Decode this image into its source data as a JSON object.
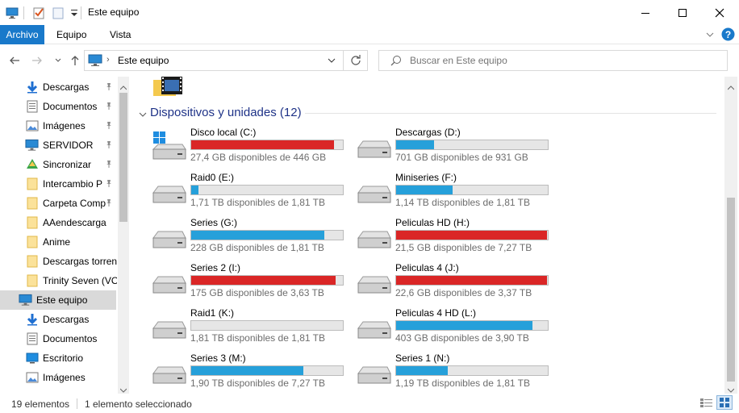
{
  "window": {
    "title": "Este equipo"
  },
  "ribbon": {
    "tabs": [
      "Archivo",
      "Equipo",
      "Vista"
    ]
  },
  "address": {
    "path": "Este equipo"
  },
  "search": {
    "placeholder": "Buscar en Este equipo"
  },
  "sidebar": {
    "items": [
      {
        "label": "Descargas",
        "icon": "download-arrow-icon",
        "pinned": true
      },
      {
        "label": "Documentos",
        "icon": "document-icon",
        "pinned": true
      },
      {
        "label": "Imágenes",
        "icon": "pictures-icon",
        "pinned": true
      },
      {
        "label": "SERVIDOR",
        "icon": "monitor-icon",
        "pinned": true
      },
      {
        "label": "Sincronizar",
        "icon": "sync-folder-icon",
        "pinned": true
      },
      {
        "label": "Intercambio P",
        "icon": "folder-icon",
        "pinned": true
      },
      {
        "label": "Carpeta Comp",
        "icon": "folder-icon",
        "pinned": true
      },
      {
        "label": "AAendescarga",
        "icon": "folder-icon",
        "pinned": false
      },
      {
        "label": "Anime",
        "icon": "folder-icon",
        "pinned": false
      },
      {
        "label": "Descargas torrent",
        "icon": "folder-icon",
        "pinned": false
      },
      {
        "label": "Trinity Seven (VOS",
        "icon": "folder-icon",
        "pinned": false
      },
      {
        "label": "Este equipo",
        "icon": "monitor-icon",
        "pinned": false,
        "selected": true
      },
      {
        "label": "Descargas",
        "icon": "download-arrow-icon",
        "pinned": false
      },
      {
        "label": "Documentos",
        "icon": "document-icon",
        "pinned": false
      },
      {
        "label": "Escritorio",
        "icon": "desktop-icon",
        "pinned": false
      },
      {
        "label": "Imágenes",
        "icon": "pictures-icon",
        "pinned": false
      }
    ]
  },
  "group": {
    "title": "Dispositivos y unidades (12)"
  },
  "drives": [
    {
      "name": "Disco local (C:)",
      "free": "27,4 GB disponibles de 446 GB",
      "used": 0.94,
      "status": "low",
      "icon": "windows-drive-icon"
    },
    {
      "name": "Descargas (D:)",
      "free": "701 GB disponibles de 931 GB",
      "used": 0.25,
      "status": "ok",
      "icon": "drive-icon"
    },
    {
      "name": "Raid0 (E:)",
      "free": "1,71 TB disponibles de 1,81 TB",
      "used": 0.05,
      "status": "ok",
      "icon": "drive-icon"
    },
    {
      "name": "Miniseries (F:)",
      "free": "1,14 TB disponibles de 1,81 TB",
      "used": 0.37,
      "status": "ok",
      "icon": "drive-icon"
    },
    {
      "name": "Series (G:)",
      "free": "228 GB disponibles de 1,81 TB",
      "used": 0.88,
      "status": "ok",
      "icon": "drive-icon"
    },
    {
      "name": "Peliculas HD (H:)",
      "free": "21,5 GB disponibles de 7,27 TB",
      "used": 0.997,
      "status": "low",
      "icon": "drive-icon"
    },
    {
      "name": "Series 2 (I:)",
      "free": "175 GB disponibles de 3,63 TB",
      "used": 0.95,
      "status": "low",
      "icon": "drive-icon"
    },
    {
      "name": "Peliculas 4 (J:)",
      "free": "22,6 GB disponibles de 3,37 TB",
      "used": 0.993,
      "status": "low",
      "icon": "drive-icon"
    },
    {
      "name": "Raid1 (K:)",
      "free": "1,81 TB disponibles de 1,81 TB",
      "used": 0.0,
      "status": "ok",
      "icon": "drive-icon"
    },
    {
      "name": "Peliculas 4 HD (L:)",
      "free": "403 GB disponibles de 3,90 TB",
      "used": 0.9,
      "status": "ok",
      "icon": "drive-icon"
    },
    {
      "name": "Series 3 (M:)",
      "free": "1,90 TB disponibles de 7,27 TB",
      "used": 0.74,
      "status": "ok",
      "icon": "drive-icon"
    },
    {
      "name": "Series 1 (N:)",
      "free": "1,19 TB disponibles de 1,81 TB",
      "used": 0.34,
      "status": "ok",
      "icon": "drive-icon"
    }
  ],
  "status": {
    "count": "19 elementos",
    "selection": "1 elemento seleccionado"
  },
  "colors": {
    "bar_ok": "#26a0da",
    "bar_low": "#da2626",
    "accent": "#1979ca",
    "group_header": "#1e3287"
  }
}
